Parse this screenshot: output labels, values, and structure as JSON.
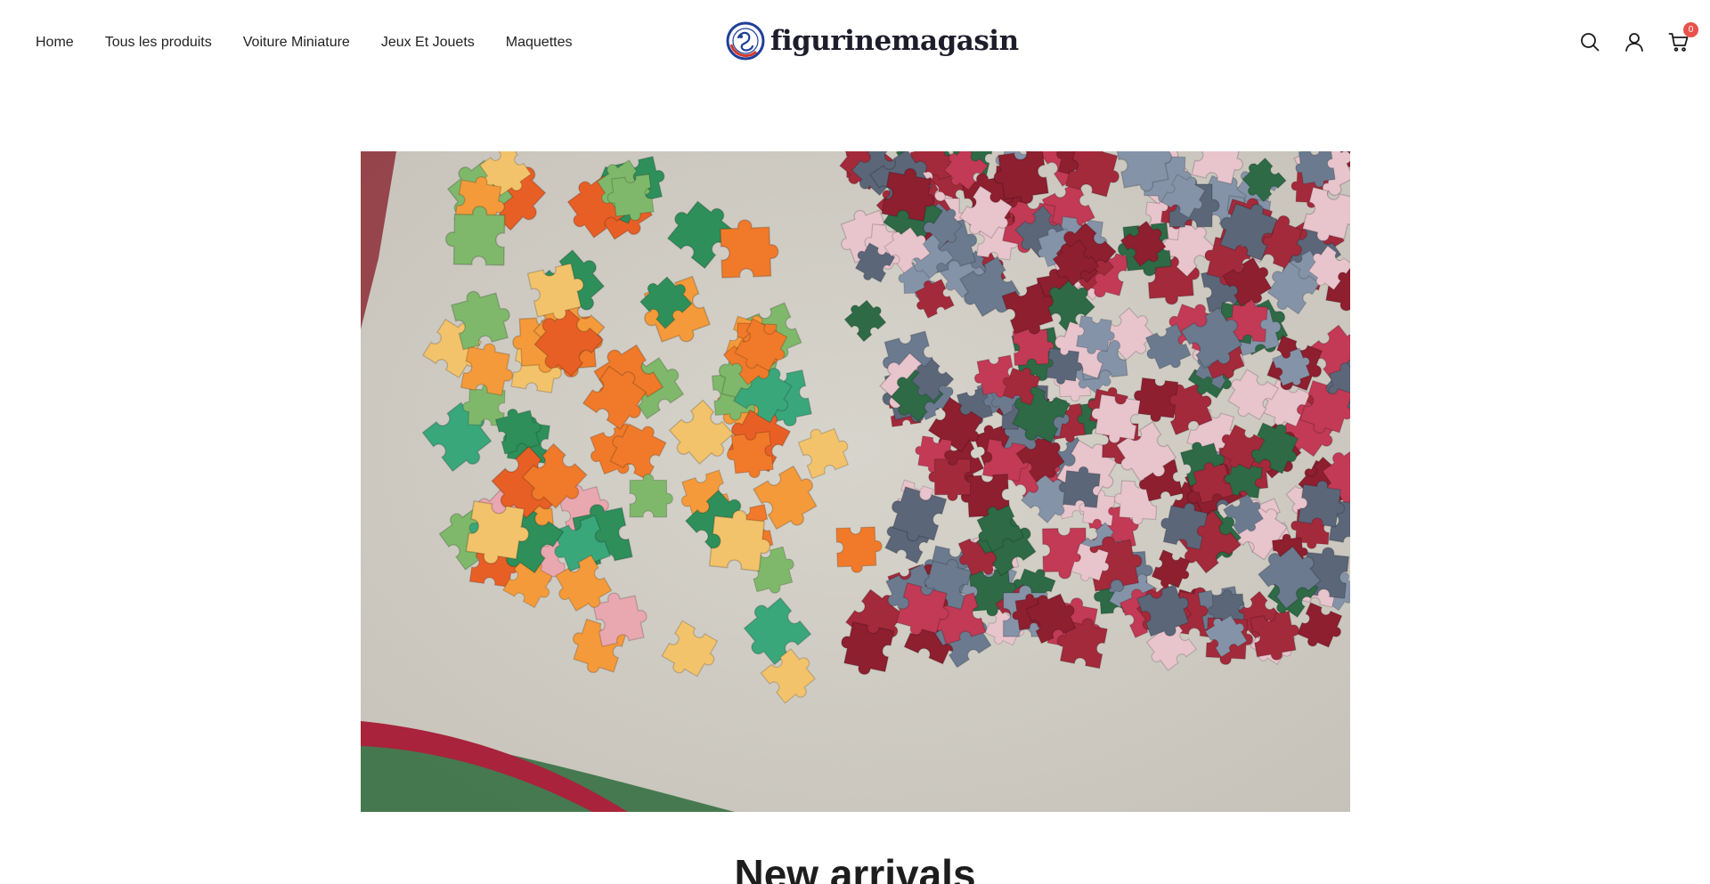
{
  "nav": {
    "items": [
      {
        "label": "Home"
      },
      {
        "label": "Tous les produits"
      },
      {
        "label": "Voiture Miniature"
      },
      {
        "label": "Jeux Et Jouets"
      },
      {
        "label": "Maquettes"
      }
    ]
  },
  "brand": {
    "name": "figurinemagasin",
    "colors": {
      "ring": "#1f3f9a",
      "ring_accent": "#d33a2c"
    }
  },
  "header_icons": {
    "search": "search-icon",
    "account": "user-icon",
    "cart": "cart-icon",
    "cart_count": "0",
    "badge_color": "#e8524a"
  },
  "hero": {
    "image": "jigsaw-puzzle-pieces-photo"
  },
  "sections": {
    "new_arrivals_title": "New arrivals"
  }
}
